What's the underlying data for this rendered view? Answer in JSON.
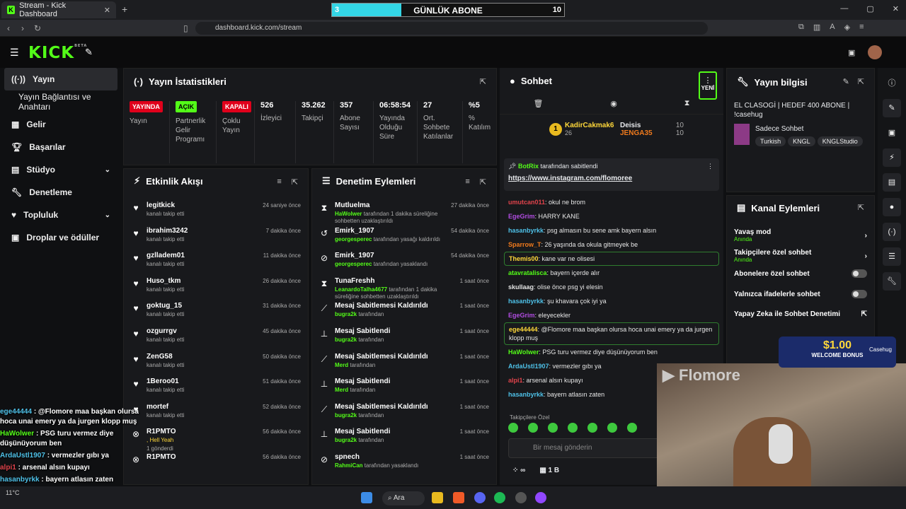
{
  "browser": {
    "tab_title": "Stream - Kick Dashboard",
    "url": "dashboard.kick.com/stream"
  },
  "sub_goal": {
    "current": "3",
    "label": "GÜNLÜK ABONE",
    "target": "10",
    "progress": 0.3
  },
  "app": {
    "logo": "KICK",
    "beta": "BETA"
  },
  "sidebar": {
    "items": [
      {
        "label": "Yayın",
        "icon": "broadcast-icon"
      },
      {
        "label": "Yayın Bağlantısı ve Anahtarı"
      },
      {
        "label": "Gelir",
        "icon": "grid-icon"
      },
      {
        "label": "Başarılar",
        "icon": "trophy-icon"
      },
      {
        "label": "Stüdyo",
        "icon": "studio-icon"
      },
      {
        "label": "Denetleme",
        "icon": "wrench-icon"
      },
      {
        "label": "Topluluk",
        "icon": "community-icon"
      },
      {
        "label": "Droplar ve ödüller",
        "icon": "gift-icon"
      }
    ]
  },
  "stats": {
    "title": "Yayın İstatistikleri",
    "cols": [
      {
        "value": "YAYINDA",
        "label": "Yayın",
        "badge": true,
        "color": "#e0001b",
        "text": "#fff"
      },
      {
        "value": "AÇIK",
        "label": "Partnerlik Gelir Programı",
        "badge": true,
        "color": "#53fc18",
        "text": "#000"
      },
      {
        "value": "KAPALI",
        "label": "Çoklu Yayın",
        "badge": true,
        "color": "#e0001b",
        "text": "#fff"
      },
      {
        "value": "526",
        "label": "İzleyici"
      },
      {
        "value": "35.262",
        "label": "Takipçi"
      },
      {
        "value": "357",
        "label": "Abone Sayısı"
      },
      {
        "value": "06:58:54",
        "label": "Yayında Olduğu Süre"
      },
      {
        "value": "27",
        "label": "Ort. Sohbete Katılanlar"
      },
      {
        "value": "%5",
        "label": "% Katılım"
      }
    ]
  },
  "activity": {
    "title": "Etkinlik Akışı",
    "rows": [
      {
        "name": "legitkick",
        "sub": "kanalı takip etti",
        "time": "24 saniye önce"
      },
      {
        "name": "ibrahim3242",
        "sub": "kanalı takip etti",
        "time": "7 dakika önce"
      },
      {
        "name": "gzlladem01",
        "sub": "kanalı takip etti",
        "time": "11 dakika önce"
      },
      {
        "name": "Huso_tkm",
        "sub": "kanalı takip etti",
        "time": "26 dakika önce"
      },
      {
        "name": "goktug_15",
        "sub": "kanalı takip etti",
        "time": "31 dakika önce"
      },
      {
        "name": "ozgurrgv",
        "sub": "kanalı takip etti",
        "time": "45 dakika önce"
      },
      {
        "name": "ZenG58",
        "sub": "kanalı takip etti",
        "time": "50 dakika önce"
      },
      {
        "name": "1Beroo01",
        "sub": "kanalı takip etti",
        "time": "51 dakika önce"
      },
      {
        "name": "mortef",
        "sub": "kanalı takip etti",
        "time": "52 dakika önce"
      },
      {
        "name": "R1PMTO",
        "sub": ", Hell Yeah",
        "sub2": "1 gönderdi",
        "time": "56 dakika önce"
      },
      {
        "name": "R1PMTO",
        "sub": "",
        "time": "56 dakika önce"
      }
    ]
  },
  "moderation": {
    "title": "Denetim Eylemleri",
    "rows": [
      {
        "icon": "timer-icon",
        "name": "Mutluelma",
        "actor": "HaWolwer",
        "text": " tarafından 1 dakika süreliğine sohbetten uzaklaştırıldı",
        "time": "27 dakika önce"
      },
      {
        "icon": "unban-icon",
        "name": "Emirk_1907",
        "actor": "georgesperec",
        "text": " tarafından yasağı kaldırıldı",
        "time": "54 dakika önce"
      },
      {
        "icon": "ban-icon",
        "name": "Emirk_1907",
        "actor": "georgesperec",
        "text": " tarafından yasaklandı",
        "time": "54 dakika önce"
      },
      {
        "icon": "timer-icon",
        "name": "TunaFreshh",
        "actor": "LeanardoTalha4677",
        "text": " tarafından 1 dakika süreliğine sohbetten uzaklaştırıldı",
        "time": "1 saat önce"
      },
      {
        "icon": "unpin-icon",
        "name": "Mesaj Sabitlemesi Kaldırıldı",
        "actor": "bugra2k",
        "text": " tarafından",
        "time": "1 saat önce"
      },
      {
        "icon": "pin-icon",
        "name": "Mesaj Sabitlendi",
        "actor": "bugra2k",
        "text": " tarafından",
        "time": "1 saat önce"
      },
      {
        "icon": "unpin-icon",
        "name": "Mesaj Sabitlemesi Kaldırıldı",
        "actor": "Merd",
        "text": " tarafından",
        "time": "1 saat önce"
      },
      {
        "icon": "pin-icon",
        "name": "Mesaj Sabitlendi",
        "actor": "Merd",
        "text": " tarafından",
        "time": "1 saat önce"
      },
      {
        "icon": "unpin-icon",
        "name": "Mesaj Sabitlemesi Kaldırıldı",
        "actor": "bugra2k",
        "text": " tarafından",
        "time": "1 saat önce"
      },
      {
        "icon": "pin-icon",
        "name": "Mesaj Sabitlendi",
        "actor": "bugra2k",
        "text": " tarafından",
        "time": "1 saat önce"
      },
      {
        "icon": "ban-icon",
        "name": "spnech",
        "actor": "RahmiCan",
        "text": " tarafından yasaklandı",
        "time": "1 saat önce"
      }
    ]
  },
  "chat": {
    "title": "Sohbet",
    "new": "YENİ",
    "leader": {
      "rank": "1",
      "name": "KadirCakmak6",
      "count": "26",
      "n2": "Deisis",
      "c2": "10",
      "n3": "JENGA35",
      "c3": "10"
    },
    "pinned": {
      "by": "BotRix",
      "by_text": "tarafından sabitlendi",
      "link": "https://www.instagram.com/flomoree"
    },
    "messages": [
      {
        "user": "umutcan011",
        "color": "#e0434b",
        "text": ": okul ne brom"
      },
      {
        "user": "EgeGrim",
        "color": "#b04ce0",
        "text": ": HARRY KANE"
      },
      {
        "user": "hasanbyrkk",
        "color": "#4ec1e8",
        "text": ": psg almasın bu sene amk bayern alsın"
      },
      {
        "user": "Sparrow_T",
        "color": "#f07a1c",
        "text": ": 26 yaşında da okula gitmeyek be"
      },
      {
        "user": "Themis00",
        "color": "#ffd83a",
        "text": ": kane var ne olisesi",
        "hl": true
      },
      {
        "user": "atavratalisca",
        "color": "#53fc18",
        "text": ": bayern içerde alır"
      },
      {
        "user": "skullaag",
        "color": "#e6e6e6",
        "text": ": olise önce psg yi elesin"
      },
      {
        "user": "hasanbyrkk",
        "color": "#4ec1e8",
        "text": ": şu khavara çok iyi ya"
      },
      {
        "user": "EgeGrim",
        "color": "#b04ce0",
        "text": ": eleyecekler"
      },
      {
        "user": "ege44444",
        "color": "#ffd83a",
        "text": ": @Flomore maa başkan olursa hoca unai emery ya da jurgen klopp muş",
        "hl": true
      },
      {
        "user": "HaWolwer",
        "color": "#53fc18",
        "text": ": PSG turu vermez diye düşünüyorum ben"
      },
      {
        "user": "ArdaUstl1907",
        "color": "#4ec1e8",
        "text": ": vermezler gıbı ya"
      },
      {
        "user": "alpi1",
        "color": "#e0434b",
        "text": ": arsenal alsın kupayı"
      },
      {
        "user": "hasanbyrkk",
        "color": "#4ec1e8",
        "text": ": bayern atlasın zaten"
      }
    ],
    "followers_only": "Takipçilere Özel",
    "input_placeholder": "Bir mesaj gönderin",
    "viewers": "∞",
    "count": "1 B"
  },
  "info": {
    "title": "Yayın bilgisi",
    "stream_title": "EL CLASOGİ | HEDEF 400 ABONE | !casehug",
    "category": "Sadece Sohbet",
    "tags": [
      "Turkish",
      "KNGL",
      "KNGLStudio"
    ]
  },
  "channel_actions": {
    "title": "Kanal Eylemleri",
    "items": [
      {
        "label": "Yavaş mod",
        "sub": "Anında",
        "kind": "arrow"
      },
      {
        "label": "Takipçilere özel sohbet",
        "sub": "Anında",
        "kind": "arrow"
      },
      {
        "label": "Abonelere özel sohbet",
        "kind": "toggle"
      },
      {
        "label": "Yalnızca ifadelerle sohbet",
        "kind": "toggle"
      },
      {
        "label": "Yapay Zeka ile Sohbet Denetimi",
        "kind": "link"
      }
    ]
  },
  "overlay": [
    {
      "user": "ege44444",
      "text": " : @Flomore maa başkan olursa hoca unai emery ya da jurgen klopp muş"
    },
    {
      "user": "HaWolwer",
      "text": " : PSG turu vermez diye düşünüyorum ben"
    },
    {
      "user": "ArdaUstl1907",
      "text": " : vermezler gıbı ya"
    },
    {
      "user": "alpi1",
      "text": " : arsenal alsın kupayı"
    },
    {
      "user": "hasanbyrkk",
      "text": " : bayern atlasın zaten"
    }
  ],
  "cam": {
    "brand": "Flomore",
    "promo_amount": "$1.00",
    "promo_text": "WELCOME BONUS",
    "promo_brand": "Casehug"
  },
  "taskbar": {
    "search": "Ara",
    "temp": "11°C"
  }
}
